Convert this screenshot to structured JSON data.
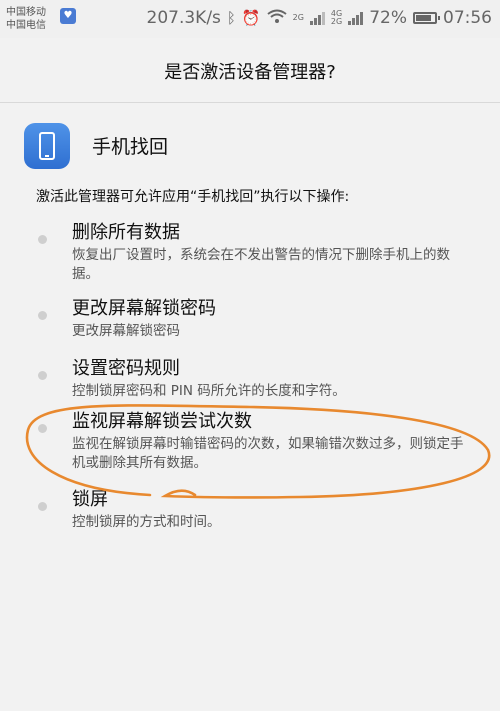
{
  "status_bar": {
    "carrier1": "中国移动",
    "carrier2": "中国电信",
    "net_speed": "207.3K/s",
    "net_small1": "2G",
    "net_small2a": "4G",
    "net_small2b": "2G",
    "battery": "72%",
    "time": "07:56"
  },
  "dialog": {
    "title": "是否激活设备管理器?",
    "app_name": "手机找回",
    "intro": "激活此管理器可允许应用“手机找回”执行以下操作:"
  },
  "permissions": [
    {
      "title": "删除所有数据",
      "desc": "恢复出厂设置时，系统会在不发出警告的情况下删除手机上的数据。"
    },
    {
      "title": "更改屏幕解锁密码",
      "desc": "更改屏幕解锁密码"
    },
    {
      "title": "设置密码规则",
      "desc": "控制锁屏密码和 PIN 码所允许的长度和字符。"
    },
    {
      "title": "监视屏幕解锁尝试次数",
      "desc": "监视在解锁屏幕时输错密码的次数，如果输错次数过多，则锁定手机或删除其所有数据。"
    },
    {
      "title": "锁屏",
      "desc": "控制锁屏的方式和时间。"
    }
  ],
  "colors": {
    "annotation": "#e8892f",
    "app_icon": "#3d7fdd"
  }
}
